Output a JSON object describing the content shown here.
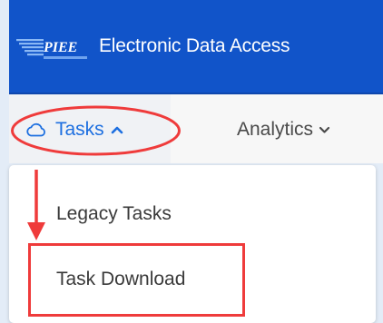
{
  "header": {
    "logo_text": "PIEE",
    "app_title": "Electronic Data Access"
  },
  "nav": {
    "tasks_label": "Tasks",
    "tasks_icon": "cloud-icon",
    "tasks_caret": "chevron-up-icon",
    "analytics_label": "Analytics",
    "analytics_caret": "chevron-down-icon"
  },
  "dropdown": {
    "items": [
      {
        "label": "Legacy Tasks"
      },
      {
        "label": "Task Download"
      }
    ]
  },
  "colors": {
    "header_bg": "#1154c9",
    "accent": "#1d6fe0",
    "annotation": "#ef3b3b"
  }
}
